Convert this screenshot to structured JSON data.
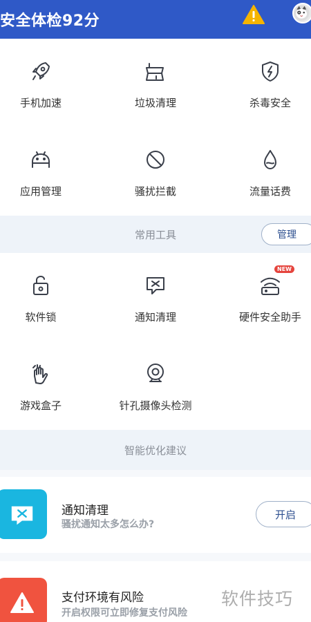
{
  "header": {
    "title": "安全体检92分",
    "warning_icon": "warning-icon",
    "avatar_icon": "cat-avatar"
  },
  "tools_top": [
    {
      "label": "手机加速",
      "icon": "rocket-icon"
    },
    {
      "label": "垃圾清理",
      "icon": "broom-icon"
    },
    {
      "label": "杀毒安全",
      "icon": "shield-bolt-icon"
    },
    {
      "label": "应用管理",
      "icon": "android-icon"
    },
    {
      "label": "骚扰拦截",
      "icon": "block-icon"
    },
    {
      "label": "流量话费",
      "icon": "water-drop-icon"
    }
  ],
  "common_tools": {
    "title": "常用工具",
    "manage_label": "管理",
    "items": [
      {
        "label": "软件锁",
        "icon": "lock-icon"
      },
      {
        "label": "通知清理",
        "icon": "message-icon"
      },
      {
        "label": "硬件安全助手",
        "icon": "wifi-router-icon",
        "badge": "NEW"
      },
      {
        "label": "游戏盒子",
        "icon": "hand-icon"
      },
      {
        "label": "针孔摄像头检测",
        "icon": "webcam-icon"
      }
    ]
  },
  "suggestions": {
    "title": "智能优化建议",
    "cards": [
      {
        "title": "通知清理",
        "subtitle": "骚扰通知太多怎么办?",
        "button": "开启",
        "icon": "notification-icon",
        "color": "#1ab6e0"
      },
      {
        "title": "支付环境有风险",
        "subtitle": "开启权限可立即修复支付风险",
        "icon": "alert-triangle-icon",
        "color": "#f0533f"
      }
    ]
  },
  "watermark": "软件技巧"
}
